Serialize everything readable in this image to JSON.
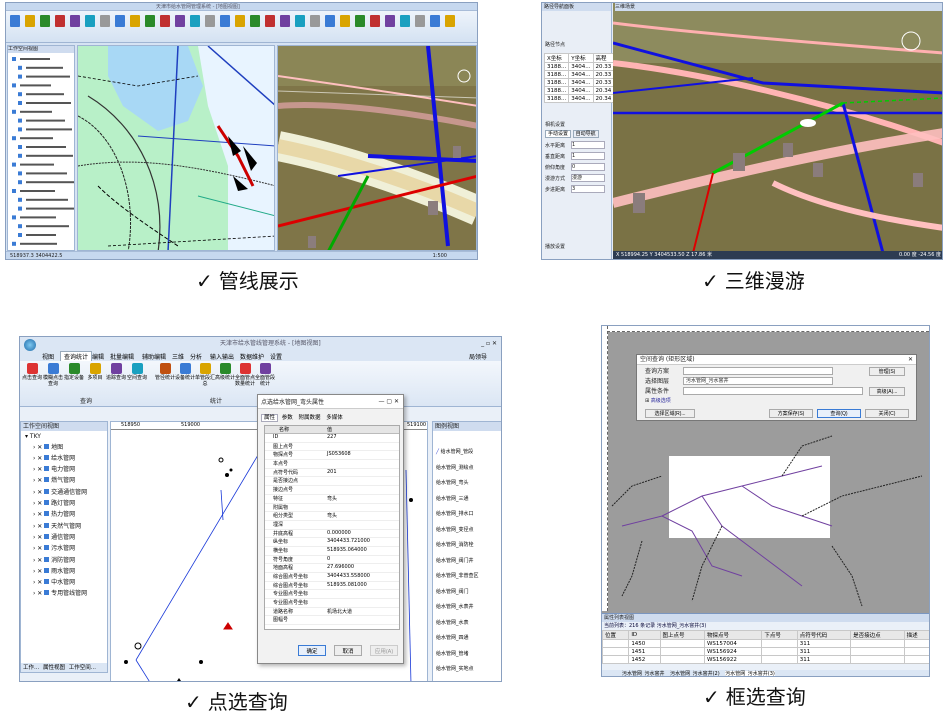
{
  "captions": [
    {
      "check": "✓",
      "text": "管线展示"
    },
    {
      "check": "✓",
      "text": "三维漫游"
    },
    {
      "check": "✓",
      "text": "点选查询"
    },
    {
      "check": "✓",
      "text": "框选查询"
    }
  ],
  "p3": {
    "window_title": "天津市给水管线管理系统 - [地图视图]",
    "user": "局领导",
    "menu": [
      "视图",
      "查询统计",
      "编辑",
      "批量编辑",
      "辅助编辑",
      "三维",
      "分析",
      "输入输出",
      "数据维护",
      "设置"
    ],
    "tools": [
      "点击查询",
      "模糊点击查询",
      "指定设备",
      "多项目",
      "追踪查询",
      "空间查询",
      "管径统计",
      "设备统计",
      "单管段汇总",
      "高级统计",
      "全面管点数量统计",
      "全面管段统计"
    ],
    "group_query": "查询",
    "group_stat": "统计",
    "tree_title": "工作空间视图",
    "tree_items": [
      "地图",
      "给水管网",
      "电力管网",
      "燃气管网",
      "交通通信管网",
      "路灯管网",
      "热力管网",
      "天然气管网",
      "通信管网",
      "污水管网",
      "消防管网",
      "雨水管网",
      "中水管网",
      "专用管线管网"
    ],
    "tree_root": "TKY",
    "right_title": "图例视图",
    "legend": [
      "给水管网_管段",
      "给水管网_测绘点",
      "给水管网_弯头",
      "给水管网_三通",
      "给水管网_排水口",
      "给水管网_变径点",
      "给水管网_消防栓",
      "给水管网_阀门井",
      "给水管网_非普查区",
      "给水管网_阀门",
      "给水管网_水表井",
      "给水管网_水表",
      "给水管网_四通",
      "给水管网_管堵",
      "给水管网_实地点"
    ],
    "ruler": [
      "518950",
      "519000",
      "519050",
      "519100"
    ],
    "bottom_tabs": [
      "工作...",
      "属性视图",
      "工作空间..."
    ],
    "dialog": {
      "title": "点选给水管网_弯头属性",
      "tabs": [
        "属性",
        "参数",
        "附属数据",
        "多媒体"
      ],
      "col_name": "名称",
      "col_value": "值",
      "rows": [
        [
          "ID",
          "227"
        ],
        [
          "图上点号",
          ""
        ],
        [
          "物探点号",
          "JS053608"
        ],
        [
          "本点号",
          ""
        ],
        [
          "点符号代码",
          "201"
        ],
        [
          "是否接边点",
          ""
        ],
        [
          "接边点号",
          ""
        ],
        [
          "特征",
          "弯头"
        ],
        [
          "附属物",
          ""
        ],
        [
          "组分类型",
          "弯头"
        ],
        [
          "埋深",
          ""
        ],
        [
          "井底高程",
          "0.000000"
        ],
        [
          "纵坐标",
          "3404433.721000"
        ],
        [
          "横坐标",
          "518935.064000"
        ],
        [
          "符号角度",
          "0"
        ],
        [
          "地面高程",
          "27.696000"
        ],
        [
          "综合图点号坐标",
          "3404433.558000"
        ],
        [
          "综合图点号坐标",
          "518935.081000"
        ],
        [
          "专业图点号坐标",
          ""
        ],
        [
          "专业图点号坐标",
          ""
        ],
        [
          "道路名称",
          "机场北大道"
        ],
        [
          "图幅号",
          ""
        ]
      ],
      "ok": "确定",
      "cancel": "取消",
      "apply": "应用(A)"
    }
  },
  "p4": {
    "dialog": {
      "title": "空间查询 (矩形区域)",
      "scheme_label": "查询方案",
      "layer_label": "选择图层",
      "layer_value": "污水管网_污水窨井",
      "cond_label": "属性条件",
      "adv_check": "高级选项",
      "manage": "管理(S)",
      "advanced": "高级(A)...",
      "select_region": "选择区域(R)...",
      "save_scheme": "方案保存(S)",
      "query": "查询(Q)",
      "close": "关闭(C)"
    },
    "list_title": "属性列表视图",
    "current": "当前列表：216 条记录  污水管网_污水窨井(3)",
    "columns": [
      "位置",
      "ID",
      "图上点号",
      "物探点号",
      "下点号",
      "点符号代码",
      "是否接边点",
      "描述"
    ],
    "rows": [
      [
        "",
        "1450",
        "",
        "WS157004",
        "",
        "311",
        "",
        ""
      ],
      [
        "",
        "1451",
        "",
        "WS156924",
        "",
        "311",
        "",
        ""
      ],
      [
        "",
        "1452",
        "",
        "WS156922",
        "",
        "311",
        "",
        ""
      ]
    ],
    "tabs": [
      "污水管网_污水窨井",
      "污水管网_污水窨井(2)",
      "污水管网_污水窨井(3)"
    ]
  },
  "p1": {
    "title": "天津市给水管网管理系统 - [地图视图]",
    "tree_title": "工作空间视图",
    "coords": "518937.3  3404422.5",
    "status": "1:500"
  },
  "p2": {
    "title": "三维场景",
    "left_title": "路径导航面板",
    "path_section": "路径节点",
    "table_cols": [
      "X坐标",
      "Y坐标",
      "高程"
    ],
    "table_rows": [
      [
        "3188...",
        "3404...",
        "20.33"
      ],
      [
        "3188...",
        "3404...",
        "20.33"
      ],
      [
        "3188...",
        "3404...",
        "20.33"
      ],
      [
        "3188...",
        "3404...",
        "20.34"
      ],
      [
        "3188...",
        "3404...",
        "20.34"
      ]
    ],
    "cam_section": "相机设置",
    "cam_tabs": [
      "手动设置",
      "自动导航"
    ],
    "params": [
      [
        "水平距离",
        "1"
      ],
      [
        "垂直距离",
        "1"
      ],
      [
        "俯仰角度",
        "0"
      ],
      [
        "漫游方式",
        "漫游"
      ],
      [
        "步进距离",
        "3"
      ]
    ],
    "play_label": "播放设置",
    "status_left": "X 518994.25  Y 3404533.50  Z 17.86 米",
    "status_right": "0.00 度  -24.56 度"
  }
}
